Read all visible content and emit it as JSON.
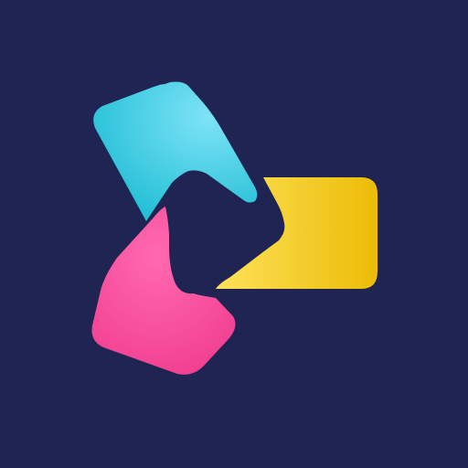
{
  "colors": {
    "background": "#1f2452",
    "cyan_light": "#7ee3f7",
    "cyan_dark": "#23bfd6",
    "yellow_light": "#fde25a",
    "yellow_dark": "#ecbc06",
    "pink_light": "#ff69b0",
    "pink_dark": "#f13d8f"
  },
  "icon": {
    "name": "video-play-logo-icon"
  }
}
